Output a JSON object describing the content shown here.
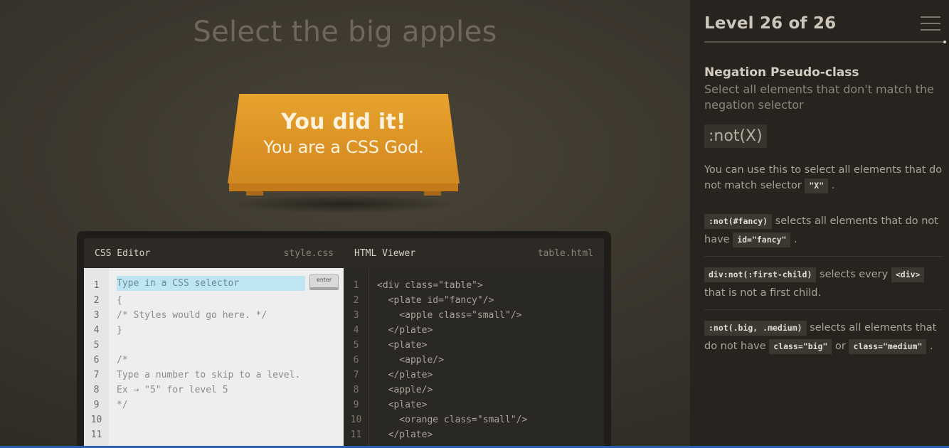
{
  "main": {
    "order": "Select the big apples",
    "win_line1": "You did it!",
    "win_line2": "You are a CSS God."
  },
  "editor": {
    "css": {
      "title": "CSS Editor",
      "file": "style.css",
      "placeholder": "Type in a CSS selector",
      "enter_label": "enter",
      "line_numbers": [
        "1",
        "2",
        "3",
        "4",
        "5",
        "6",
        "7",
        "8",
        "9",
        "10",
        "11"
      ],
      "lines": [
        "",
        "{",
        "/* Styles would go here. */",
        "}",
        "",
        "/*",
        "Type a number to skip to a level.",
        "Ex → \"5\" for level 5",
        "*/",
        "",
        ""
      ]
    },
    "html": {
      "title": "HTML Viewer",
      "file": "table.html",
      "line_numbers": [
        "1",
        "2",
        "3",
        "4",
        "5",
        "6",
        "7",
        "8",
        "9",
        "10",
        "11"
      ],
      "lines": [
        "<div class=\"table\">",
        "  <plate id=\"fancy\"/>",
        "    <apple class=\"small\"/>",
        "  </plate>",
        "  <plate>",
        "    <apple/>",
        "  </plate>",
        "  <apple/>",
        "  <plate>",
        "    <orange class=\"small\"/>",
        "  </plate>"
      ]
    }
  },
  "sidebar": {
    "level_text": "Level 26 of 26",
    "selector_name": "Negation Pseudo-class",
    "title": "Select all elements that don't match the negation selector",
    "syntax": ":not(X)",
    "hint_part1": "You can use this to select all elements that do not match selector",
    "hint_code": "\"X\"",
    "hint_part2": ".",
    "examples": [
      {
        "code1": ":not(#fancy)",
        "text1": "selects all elements that do not have",
        "code2": "id=\"fancy\"",
        "text2": "."
      },
      {
        "code1": "div:not(:first-child)",
        "text1": "selects every",
        "code2": "<div>",
        "text2": "that is not a first child."
      },
      {
        "code1": ":not(.big, .medium)",
        "text1": "selects all elements that do not have",
        "code2": "class=\"big\"",
        "text2": "or",
        "code3": "class=\"medium\"",
        "text3": "."
      }
    ]
  },
  "colors": {
    "table": "#e09a28",
    "input_highlight": "#bde6f2",
    "sidebar_bg": "#272420"
  },
  "icons": [
    "menu-icon",
    "enter-icon"
  ]
}
